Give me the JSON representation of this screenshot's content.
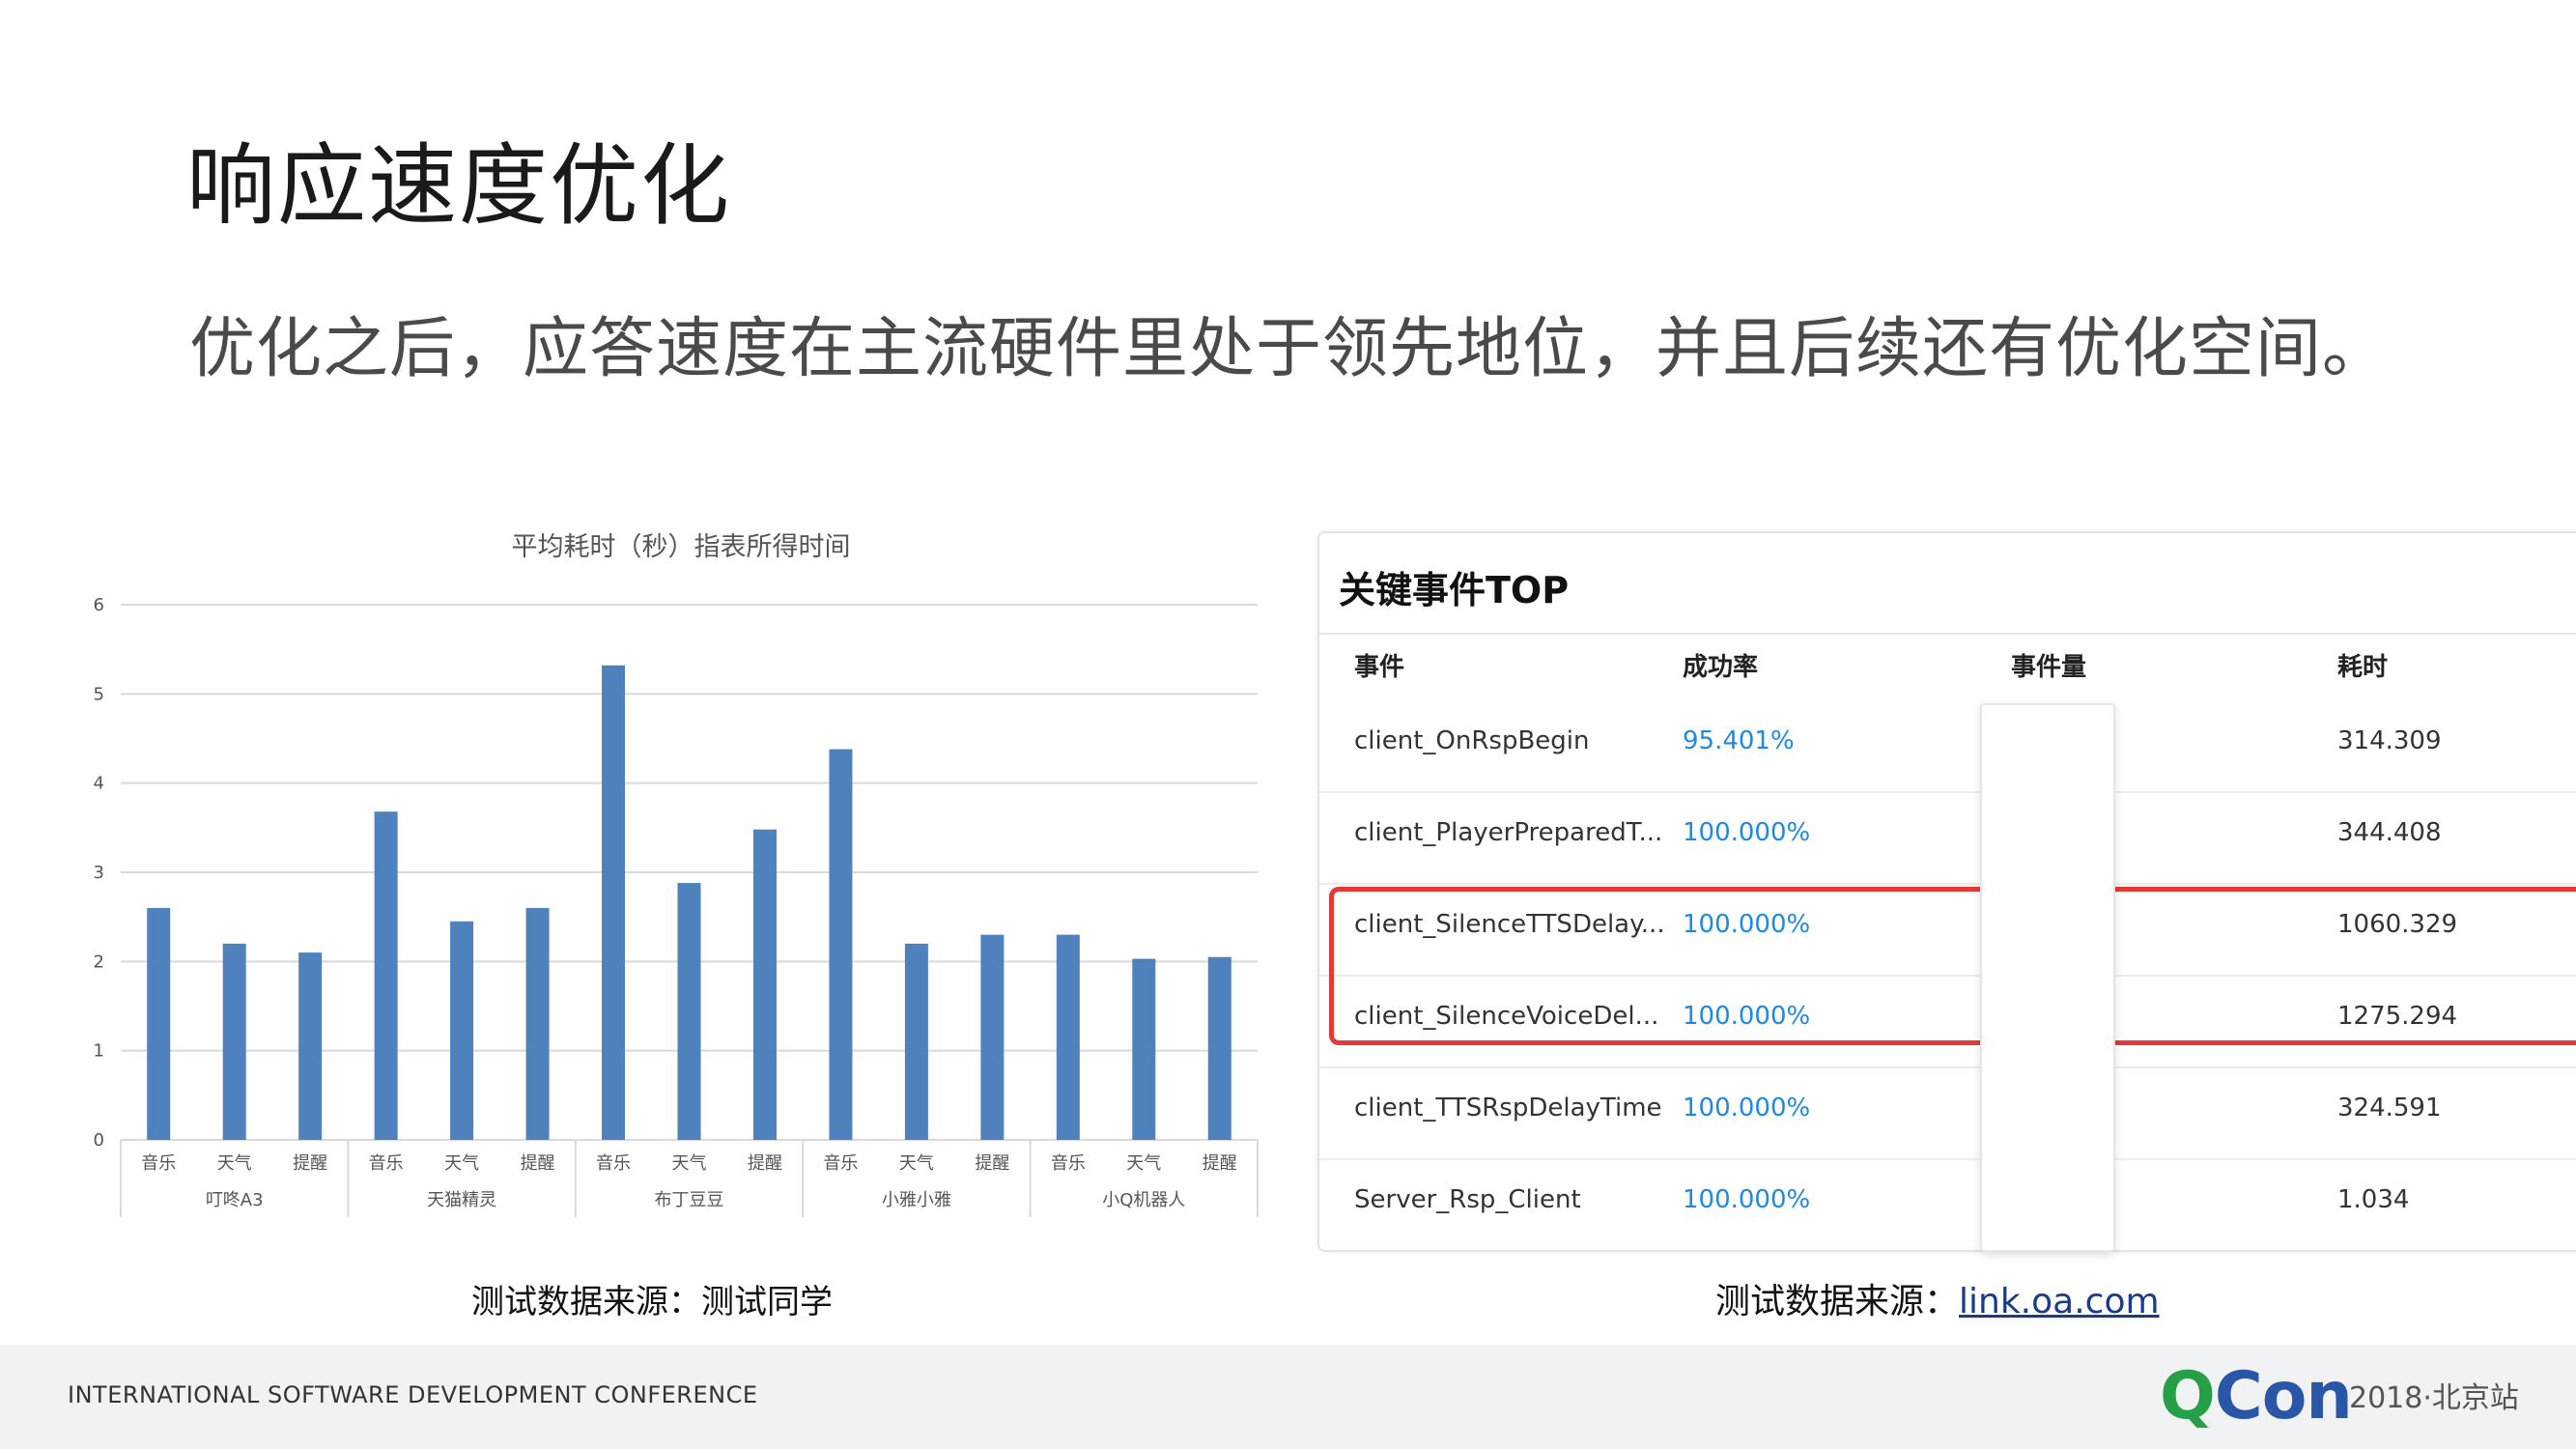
{
  "slide": {
    "title": "响应速度优化",
    "subtitle": "优化之后，应答速度在主流硬件里处于领先地位，并且后续还有优化空间。"
  },
  "chart_data": {
    "type": "bar",
    "title": "平均耗时（秒）指表所得时间",
    "ylim": [
      0,
      6
    ],
    "yticks": [
      0,
      1,
      2,
      3,
      4,
      5,
      6
    ],
    "grid": true,
    "bar_color": "#4f81bd",
    "groups": [
      {
        "name": "叮咚A3",
        "categories": [
          "音乐",
          "天气",
          "提醒"
        ],
        "values": [
          2.6,
          2.2,
          2.1
        ]
      },
      {
        "name": "天猫精灵",
        "categories": [
          "音乐",
          "天气",
          "提醒"
        ],
        "values": [
          3.68,
          2.45,
          2.6
        ]
      },
      {
        "name": "布丁豆豆",
        "categories": [
          "音乐",
          "天气",
          "提醒"
        ],
        "values": [
          5.32,
          2.88,
          3.48
        ]
      },
      {
        "name": "小雅小雅",
        "categories": [
          "音乐",
          "天气",
          "提醒"
        ],
        "values": [
          4.38,
          2.2,
          2.3
        ]
      },
      {
        "name": "小Q机器人",
        "categories": [
          "音乐",
          "天气",
          "提醒"
        ],
        "values": [
          2.3,
          2.03,
          2.05
        ]
      }
    ]
  },
  "event_table": {
    "title": "关键事件TOP",
    "columns": [
      "事件",
      "成功率",
      "事件量",
      "耗时"
    ],
    "rows": [
      {
        "event": "client_OnRspBegin",
        "rate": "95.401%",
        "time": "314.309"
      },
      {
        "event": "client_PlayerPreparedT...",
        "rate": "100.000%",
        "time": "344.408"
      },
      {
        "event": "client_SilenceTTSDelay...",
        "rate": "100.000%",
        "time": "1060.329"
      },
      {
        "event": "client_SilenceVoiceDel...",
        "rate": "100.000%",
        "time": "1275.294"
      },
      {
        "event": "client_TTSRspDelayTime",
        "rate": "100.000%",
        "time": "324.591"
      },
      {
        "event": "Server_Rsp_Client",
        "rate": "100.000%",
        "time": "1.034"
      }
    ],
    "highlight_color": "#e53935",
    "rate_color": "#1e88e5"
  },
  "sources": {
    "left": "测试数据来源：测试同学",
    "right_prefix": "测试数据来源：",
    "right_link": "link.oa.com"
  },
  "footer": {
    "conference": "INTERNATIONAL SOFTWARE DEVELOPMENT CONFERENCE",
    "logo_q": "Q",
    "logo_rest": "Con",
    "edition": "2018·北京站"
  }
}
